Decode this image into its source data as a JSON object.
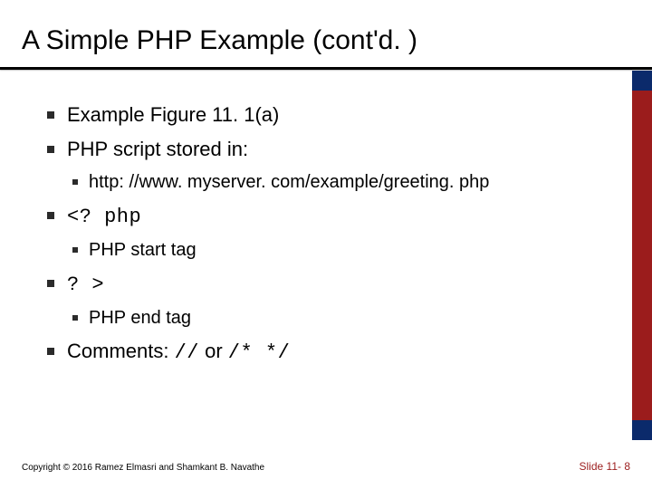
{
  "title": "A Simple PHP Example (cont'd. )",
  "bullets": {
    "b1": "Example Figure 11. 1(a)",
    "b2": "PHP script stored in:",
    "b2_sub": "http: //www. myserver. com/example/greeting. php",
    "b3": "<? php",
    "b3_sub": "PHP start tag",
    "b4": "? >",
    "b4_sub": "PHP end tag",
    "b5_prefix": "Comments: ",
    "b5_code1": "//",
    "b5_mid": " or ",
    "b5_code2": "/*  */"
  },
  "footer": {
    "copyright": "Copyright © 2016 Ramez Elmasri and Shamkant B. Navathe",
    "slidenum": "Slide 11- 8"
  }
}
